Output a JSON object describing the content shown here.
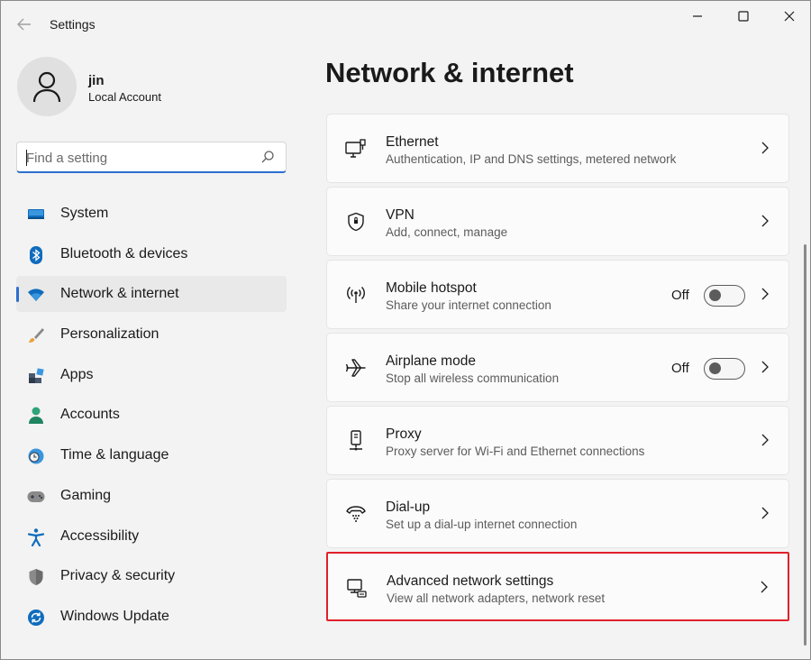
{
  "window": {
    "title": "Settings"
  },
  "profile": {
    "name": "jin",
    "account_type": "Local Account"
  },
  "search": {
    "placeholder": "Find a setting",
    "value": ""
  },
  "sidebar": {
    "items": [
      {
        "label": "System",
        "icon": "monitor-icon",
        "selected": false
      },
      {
        "label": "Bluetooth & devices",
        "icon": "bluetooth-icon",
        "selected": false
      },
      {
        "label": "Network & internet",
        "icon": "wifi-icon",
        "selected": true
      },
      {
        "label": "Personalization",
        "icon": "brush-icon",
        "selected": false
      },
      {
        "label": "Apps",
        "icon": "apps-icon",
        "selected": false
      },
      {
        "label": "Accounts",
        "icon": "person-icon",
        "selected": false
      },
      {
        "label": "Time & language",
        "icon": "clock-globe-icon",
        "selected": false
      },
      {
        "label": "Gaming",
        "icon": "gamepad-icon",
        "selected": false
      },
      {
        "label": "Accessibility",
        "icon": "accessibility-icon",
        "selected": false
      },
      {
        "label": "Privacy & security",
        "icon": "shield-icon",
        "selected": false
      },
      {
        "label": "Windows Update",
        "icon": "update-icon",
        "selected": false
      }
    ]
  },
  "main": {
    "title": "Network & internet",
    "cards": [
      {
        "title": "Ethernet",
        "description": "Authentication, IP and DNS settings, metered network",
        "icon": "ethernet-icon"
      },
      {
        "title": "VPN",
        "description": "Add, connect, manage",
        "icon": "vpn-shield-icon"
      },
      {
        "title": "Mobile hotspot",
        "description": "Share your internet connection",
        "icon": "hotspot-icon",
        "toggle": {
          "label": "Off",
          "on": false
        }
      },
      {
        "title": "Airplane mode",
        "description": "Stop all wireless communication",
        "icon": "airplane-icon",
        "toggle": {
          "label": "Off",
          "on": false
        }
      },
      {
        "title": "Proxy",
        "description": "Proxy server for Wi-Fi and Ethernet connections",
        "icon": "proxy-icon"
      },
      {
        "title": "Dial-up",
        "description": "Set up a dial-up internet connection",
        "icon": "dialup-icon"
      },
      {
        "title": "Advanced network settings",
        "description": "View all network adapters, network reset",
        "icon": "advanced-network-icon",
        "highlighted": true
      }
    ]
  },
  "colors": {
    "accent": "#2b6fcf",
    "highlight_border": "#e0202a",
    "background": "#f3f3f3"
  }
}
